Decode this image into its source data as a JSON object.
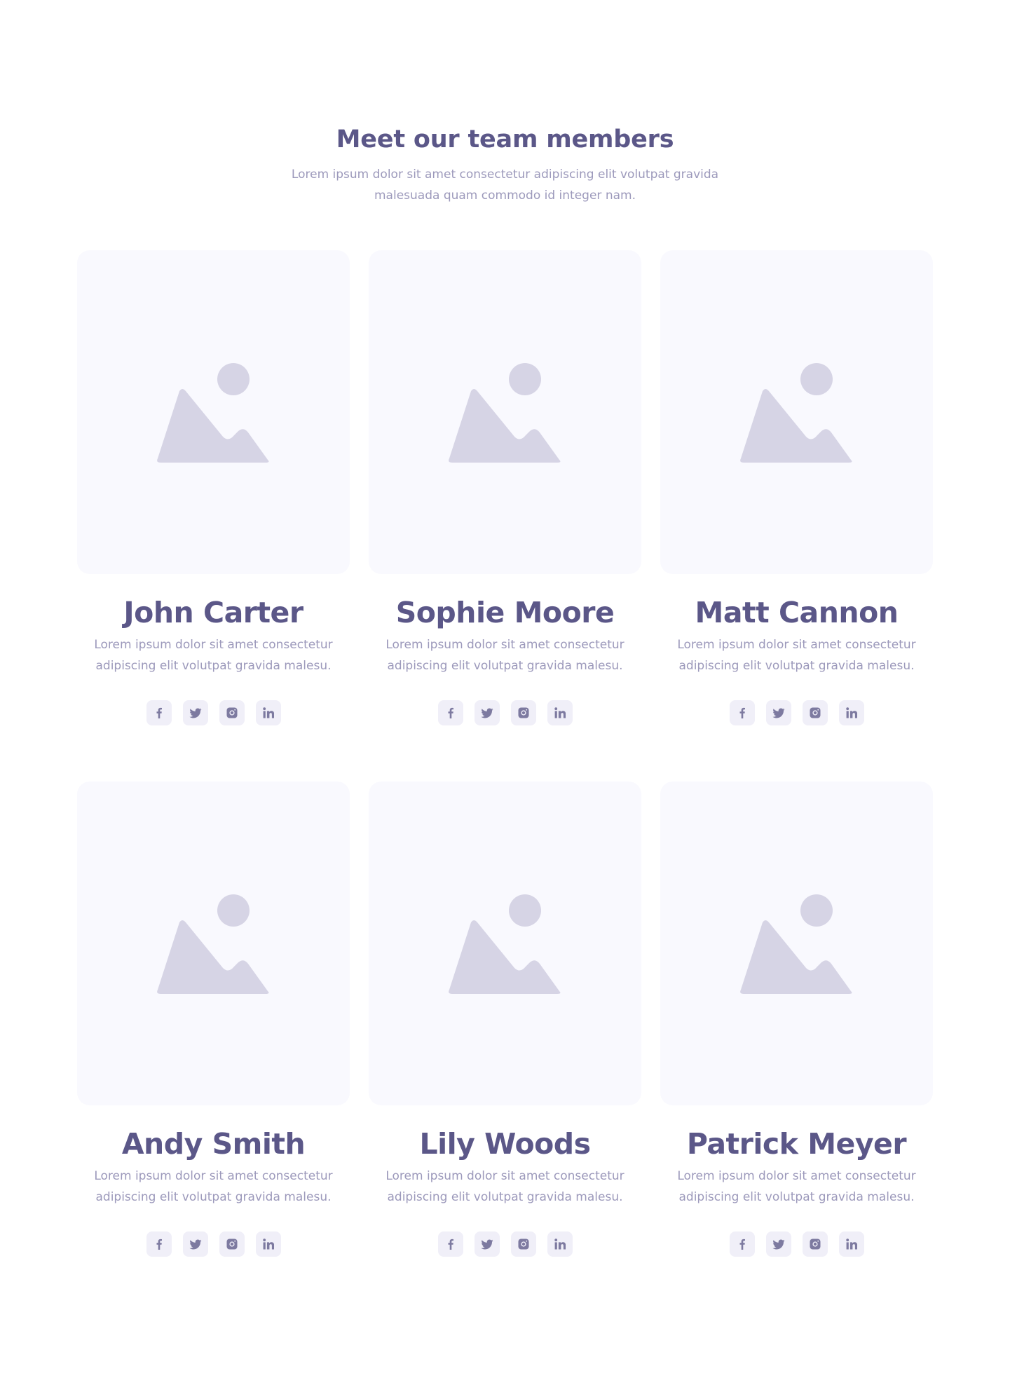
{
  "header": {
    "title": "Meet our team members",
    "subtitle": "Lorem ipsum dolor sit amet consectetur adipiscing elit volutpat gravida malesuada quam commodo id integer nam."
  },
  "colors": {
    "heading": "#5b5788",
    "body_text": "#9c99bb",
    "card_background": "#f9f9fe",
    "placeholder_shape": "#d6d4e5",
    "social_background": "#f0eff8",
    "social_icon": "#7d7aa0"
  },
  "team": [
    {
      "name": "John Carter",
      "bio": "Lorem ipsum dolor sit amet consectetur adipiscing elit volutpat gravida malesu.",
      "photo_icon": "image-placeholder-icon",
      "socials": [
        "facebook-icon",
        "twitter-icon",
        "instagram-icon",
        "linkedin-icon"
      ]
    },
    {
      "name": "Sophie Moore",
      "bio": "Lorem ipsum dolor sit amet consectetur adipiscing elit volutpat gravida malesu.",
      "photo_icon": "image-placeholder-icon",
      "socials": [
        "facebook-icon",
        "twitter-icon",
        "instagram-icon",
        "linkedin-icon"
      ]
    },
    {
      "name": "Matt Cannon",
      "bio": "Lorem ipsum dolor sit amet consectetur adipiscing elit volutpat gravida malesu.",
      "photo_icon": "image-placeholder-icon",
      "socials": [
        "facebook-icon",
        "twitter-icon",
        "instagram-icon",
        "linkedin-icon"
      ]
    },
    {
      "name": "Andy Smith",
      "bio": "Lorem ipsum dolor sit amet consectetur adipiscing elit volutpat gravida malesu.",
      "photo_icon": "image-placeholder-icon",
      "socials": [
        "facebook-icon",
        "twitter-icon",
        "instagram-icon",
        "linkedin-icon"
      ]
    },
    {
      "name": "Lily Woods",
      "bio": "Lorem ipsum dolor sit amet consectetur adipiscing elit volutpat gravida malesu.",
      "photo_icon": "image-placeholder-icon",
      "socials": [
        "facebook-icon",
        "twitter-icon",
        "instagram-icon",
        "linkedin-icon"
      ]
    },
    {
      "name": "Patrick Meyer",
      "bio": "Lorem ipsum dolor sit amet consectetur adipiscing elit volutpat gravida malesu.",
      "photo_icon": "image-placeholder-icon",
      "socials": [
        "facebook-icon",
        "twitter-icon",
        "instagram-icon",
        "linkedin-icon"
      ]
    }
  ]
}
